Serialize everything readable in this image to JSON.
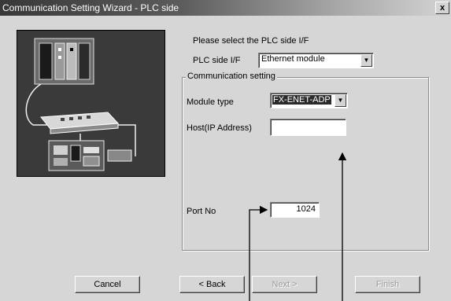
{
  "window": {
    "title": "Communication Setting Wizard - PLC side",
    "close_label": "x"
  },
  "prompt": "Please select the PLC side I/F",
  "plc_side_if": {
    "label": "PLC side I/F",
    "value": "Ethernet module"
  },
  "comm_setting": {
    "title": "Communication setting",
    "module_type": {
      "label": "Module type",
      "value": "FX-ENET-ADP"
    },
    "host": {
      "label": "Host(IP Address)",
      "value": ""
    },
    "port": {
      "label": "Port No",
      "value": "1024"
    }
  },
  "buttons": {
    "cancel": "Cancel",
    "back": "< Back",
    "next": "Next >",
    "finish": "Finish"
  }
}
